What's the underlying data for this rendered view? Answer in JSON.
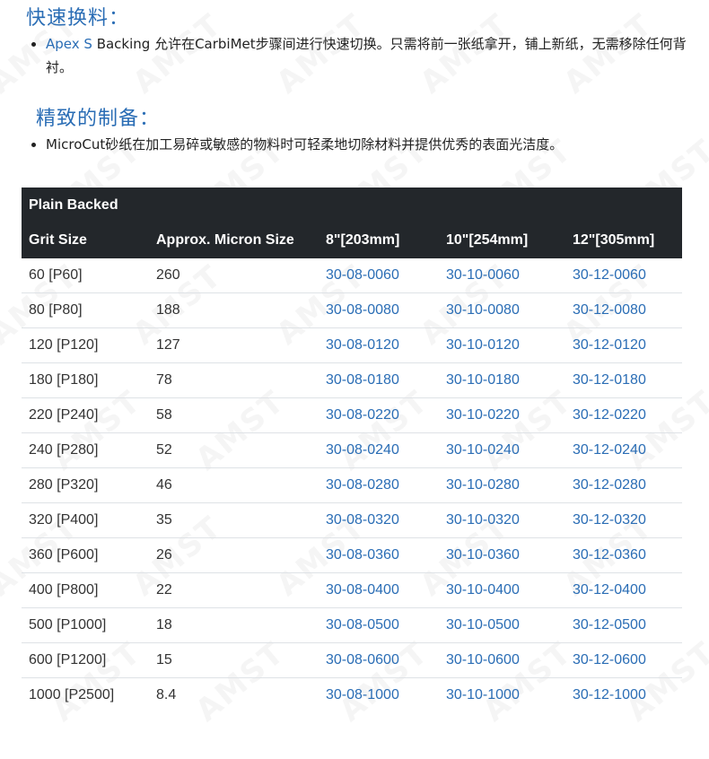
{
  "sections": [
    {
      "heading": "快速换料：",
      "bullet_link": "Apex S",
      "bullet_text": " Backing 允许在CarbiMet步骤间进行快速切换。只需将前一张纸拿开，铺上新纸，无需移除任何背衬。"
    },
    {
      "heading": "精致的制备：",
      "bullet_text": "MicroCut砂纸在加工易碎或敏感的物料时可轻柔地切除材料并提供优秀的表面光洁度。"
    }
  ],
  "watermark_text": "AMST",
  "table": {
    "title": "Plain Backed",
    "headers": [
      "Grit Size",
      "Approx. Micron Size",
      "8\"[203mm]",
      "10\"[254mm]",
      "12\"[305mm]"
    ],
    "rows": [
      [
        "60 [P60]",
        "260",
        "30-08-0060",
        "30-10-0060",
        "30-12-0060"
      ],
      [
        "80 [P80]",
        "188",
        "30-08-0080",
        "30-10-0080",
        "30-12-0080"
      ],
      [
        "120 [P120]",
        "127",
        "30-08-0120",
        "30-10-0120",
        "30-12-0120"
      ],
      [
        "180 [P180]",
        "78",
        "30-08-0180",
        "30-10-0180",
        "30-12-0180"
      ],
      [
        "220 [P240]",
        "58",
        "30-08-0220",
        "30-10-0220",
        "30-12-0220"
      ],
      [
        "240 [P280]",
        "52",
        "30-08-0240",
        "30-10-0240",
        "30-12-0240"
      ],
      [
        "280 [P320]",
        "46",
        "30-08-0280",
        "30-10-0280",
        "30-12-0280"
      ],
      [
        "320 [P400]",
        "35",
        "30-08-0320",
        "30-10-0320",
        "30-12-0320"
      ],
      [
        "360 [P600]",
        "26",
        "30-08-0360",
        "30-10-0360",
        "30-12-0360"
      ],
      [
        "400 [P800]",
        "22",
        "30-08-0400",
        "30-10-0400",
        "30-12-0400"
      ],
      [
        "500 [P1000]",
        "18",
        "30-08-0500",
        "30-10-0500",
        "30-12-0500"
      ],
      [
        "600 [P1200]",
        "15",
        "30-08-0600",
        "30-10-0600",
        "30-12-0600"
      ],
      [
        "1000 [P2500]",
        "8.4",
        "30-08-1000",
        "30-10-1000",
        "30-12-1000"
      ]
    ]
  },
  "colors": {
    "heading": "#2a6db5",
    "link": "#2a6db5",
    "table_header_bg": "#23272b",
    "row_border": "#dee2e6"
  }
}
